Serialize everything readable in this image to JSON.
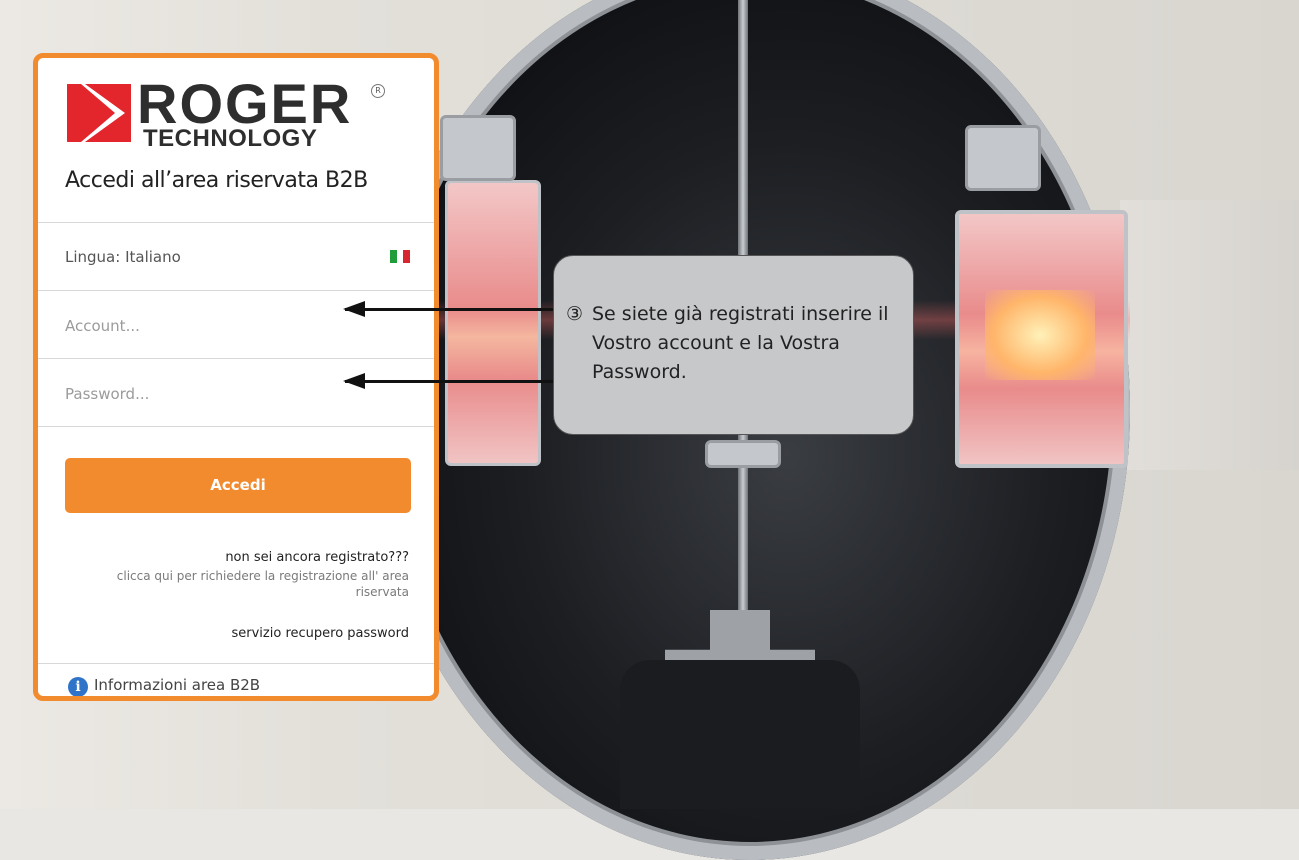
{
  "logo": {
    "brand": "ROGER",
    "sub": "TECHNOLOGY",
    "registered": "R",
    "mark_color": "#e3252c"
  },
  "login": {
    "title": "Accedi all’area riservata B2B",
    "language_label": "Lingua: Italiano",
    "language_flag_icon": "italy-flag-icon",
    "account_placeholder": "Account...",
    "password_placeholder": "Password...",
    "submit_label": "Accedi",
    "not_registered": "non sei ancora registrato???",
    "register_link": "clicca qui per richiedere la registrazione all' area riservata",
    "recover_link": "servizio recupero password",
    "info_label": "Informazioni area B2B",
    "accent_color": "#f28a2e"
  },
  "annotation": {
    "number": "③",
    "text": "Se siete già registrati inserire il  Vostro account e la Vostra Password."
  }
}
